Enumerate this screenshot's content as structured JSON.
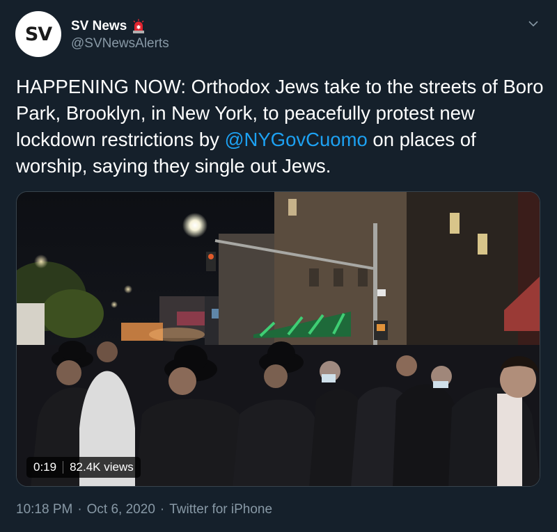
{
  "author": {
    "avatar_text": "SV",
    "display_name": "SV News",
    "handle": "@SVNewsAlerts",
    "badge_icon": "siren-emoji-icon"
  },
  "menu": {
    "icon": "chevron-down-icon"
  },
  "tweet": {
    "text_before": "HAPPENING NOW: Orthodox Jews take to the streets of Boro Park, Brooklyn, in New York, to peacefully protest new lockdown restrictions by ",
    "mention": "@NYGovCuomo",
    "text_after": " on places of worship, saying they single out Jews."
  },
  "video": {
    "duration": "0:19",
    "views": "82.4K views"
  },
  "meta": {
    "time": "10:18 PM",
    "separator": "·",
    "date": "Oct 6, 2020",
    "source": "Twitter for iPhone"
  },
  "colors": {
    "background": "#15202b",
    "text": "#ffffff",
    "secondary": "#8899a6",
    "link": "#1da1f2"
  }
}
